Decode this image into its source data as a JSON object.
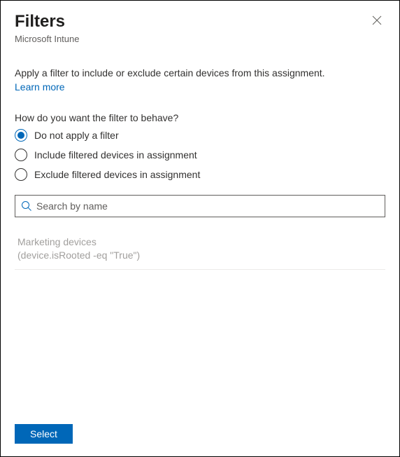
{
  "header": {
    "title": "Filters",
    "subtitle": "Microsoft Intune"
  },
  "description": "Apply a filter to include or exclude certain devices from this assignment.",
  "learn_more": "Learn more",
  "behavior": {
    "label": "How do you want the filter to behave?",
    "options": [
      {
        "id": "none",
        "label": "Do not apply a filter",
        "selected": true
      },
      {
        "id": "include",
        "label": "Include filtered devices in assignment",
        "selected": false
      },
      {
        "id": "exclude",
        "label": "Exclude filtered devices in assignment",
        "selected": false
      }
    ]
  },
  "search": {
    "placeholder": "Search by name",
    "value": ""
  },
  "filters": [
    {
      "name": "Marketing devices",
      "rule": "(device.isRooted -eq \"True\")"
    }
  ],
  "footer": {
    "select_label": "Select"
  },
  "colors": {
    "accent": "#0067b8"
  }
}
